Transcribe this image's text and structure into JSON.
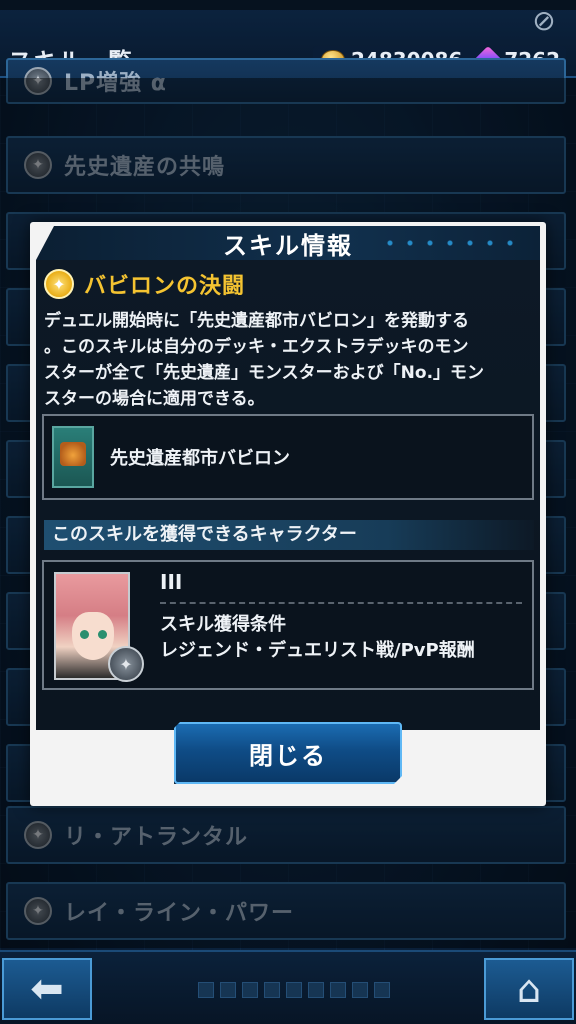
{
  "header": {
    "title": "スキル一覧",
    "coins": "24830086",
    "gems": "7262"
  },
  "skill_list": [
    {
      "label": "LP増強 α"
    },
    {
      "label": "先史遺産の共鳴"
    },
    {
      "label": "リ・アトランタル"
    },
    {
      "label": "レイ・ライン・パワー"
    }
  ],
  "modal": {
    "title": "スキル情報",
    "skill_name": "バビロンの決闘",
    "description": "デュエル開始時に「先史遺産都市バビロン」を発動する\n。このスキルは自分のデッキ・エクストラデッキのモン\nスターが全て「先史遺産」モンスターおよび「No.」モン\nスターの場合に適用できる。",
    "card_name": "先史遺産都市バビロン",
    "character_section_title": "このスキルを獲得できるキャラクター",
    "character_name": "III",
    "condition_label": "スキル獲得条件",
    "condition_value": "レジェンド・デュエリスト戦/PvP報酬",
    "close_label": "閉じる"
  },
  "icons": {
    "top_right": "crossed-out-icon",
    "back": "back-arrow-icon",
    "home": "home-icon",
    "coin": "coin-icon",
    "gem": "gem-icon"
  },
  "colors": {
    "skill_title": "#f5c431",
    "accent_blue": "#1b6cb2"
  }
}
